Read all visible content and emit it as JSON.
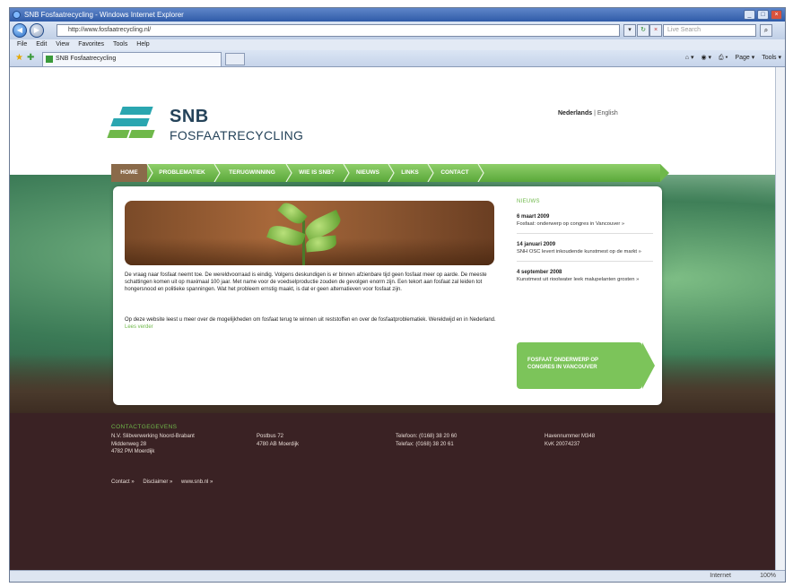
{
  "browser": {
    "window_title": "SNB Fosfaatrecycling - Windows Internet Explorer",
    "address": "http://www.fosfaatrecycling.nl/",
    "search_placeholder": "Live Search",
    "menu": [
      "File",
      "Edit",
      "View",
      "Favorites",
      "Tools",
      "Help"
    ],
    "tab_title": "SNB Fosfaatrecycling",
    "commands": [
      "Page ▾",
      "Tools ▾"
    ],
    "status_zone": "Internet",
    "status_zoom": "100%"
  },
  "site": {
    "logo_main": "SNB",
    "logo_sub": "FOSFAATRECYCLING",
    "lang_active": "Nederlands",
    "lang_sep": " | ",
    "lang_other": "English",
    "nav": [
      "HOME",
      "PROBLEMATIEK",
      "TERUGWINNING",
      "WIE IS SNB?",
      "NIEUWS",
      "LINKS",
      "CONTACT"
    ],
    "intro_p1": "De vraag naar fosfaat neemt toe. De wereldvoorraad is eindig. Volgens deskundigen is er binnen afzienbare tijd geen fosfaat meer op aarde. De meeste schattingen komen uit op maximaal 100 jaar. Met name voor de voedselproductie zouden de gevolgen enorm zijn. Een tekort aan fosfaat zal leiden tot hongersnood en politieke spanningen. Wat het probleem ernstig maakt, is dat er geen alternatieven voor fosfaat zijn.",
    "intro_p2": "Op deze website leest u meer over de mogelijkheden om fosfaat terug te winnen uit reststoffen en over de fosfaatproblematiek. Wereldwijd en in Nederland.",
    "read_more": "Lees verder",
    "news_heading": "NIEUWS",
    "news": [
      {
        "date": "6 maart 2009",
        "text": "Fosfaat: onderwerp op congres in Vancouver »"
      },
      {
        "date": "14 januari 2009",
        "text": "SNH OSC levert inkoudende kunstmest op de markt »"
      },
      {
        "date": "4 september 2008",
        "text": "Kunstmest uit rioolwater leek malupelanten grosten »"
      }
    ],
    "promo": "FOSFAAT ONDERWERP OP CONGRES IN VANCOUVER",
    "footer_heading": "CONTACTGEGEVENS",
    "footer_cols": [
      [
        "N.V. Slibverwerking Noord-Brabant",
        "Middenweg 28",
        "4782 PM Moerdijk"
      ],
      [
        "Postbus 72",
        "4780 AB Moerdijk"
      ],
      [
        "Telefoon: (0168) 38 20 60",
        "Telefax: (0168) 38 20 61"
      ],
      [
        "Havennummer M348",
        "KvK 20074237"
      ]
    ],
    "footer_links": [
      "Contact »",
      "Disclaimer »",
      "www.snb.nl »"
    ]
  },
  "colors": {
    "brand_green": "#6fb84a",
    "brand_navy": "#25435a",
    "footer": "#3a2224",
    "home_tab": "#8a6a4a"
  }
}
